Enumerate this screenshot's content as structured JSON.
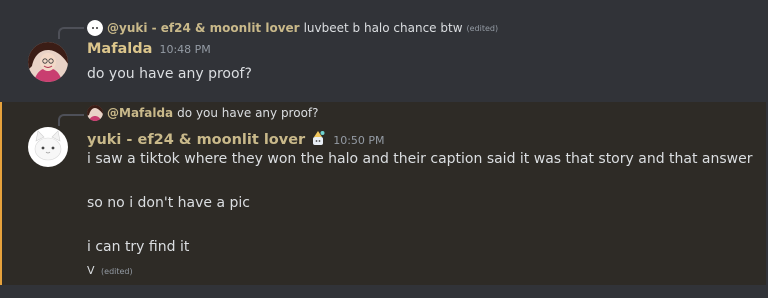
{
  "message1": {
    "reply": {
      "author": "@yuki - ef24 & moonlit lover",
      "text": "luvbeet b halo chance btw",
      "edited": "(edited)"
    },
    "author": "Mafalda",
    "timestamp": "10:48 PM",
    "content": "do you have any proof?"
  },
  "message2": {
    "reply": {
      "author": "@Mafalda",
      "text": "do you have any proof?"
    },
    "author": "yuki - ef24 & moonlit lover",
    "timestamp": "10:50 PM",
    "lines": [
      "i saw a tiktok where they won the halo and their caption said it was that story and that answer",
      "so no i don't have a pic",
      "i can try find it"
    ],
    "extra": {
      "text": "V",
      "edited": "(edited)"
    }
  },
  "colors": {
    "background": "#313338",
    "highlight": "#2e2b26",
    "highlight_border": "#e6a23c",
    "mafalda_name": "#dcc68c",
    "yuki_name": "#c9b98a"
  }
}
